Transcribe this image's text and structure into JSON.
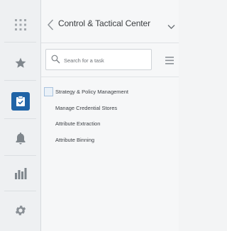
{
  "rail": {
    "items": [
      {
        "name": "apps-grid",
        "icon": "grid-icon",
        "active": false
      },
      {
        "name": "favorites",
        "icon": "star-icon",
        "active": false
      },
      {
        "name": "tasks",
        "icon": "clipboard-check-icon",
        "active": true
      },
      {
        "name": "notifications",
        "icon": "bell-icon",
        "active": false
      },
      {
        "name": "reports",
        "icon": "bar-chart-icon",
        "active": false
      },
      {
        "name": "settings",
        "icon": "gear-icon",
        "active": false
      }
    ],
    "active_color": "#1f63a6",
    "icon_color": "#9aa0a6"
  },
  "panel": {
    "title": "Control & Tactical Center",
    "search": {
      "placeholder": "Search for a task",
      "value": ""
    },
    "tasks": [
      {
        "label": "Strategy & Policy Management",
        "selected": true
      },
      {
        "label": "Manage Credential Stores",
        "selected": false
      },
      {
        "label": "Attribute Extraction",
        "selected": false
      },
      {
        "label": "Attribute Binning",
        "selected": false
      }
    ]
  }
}
